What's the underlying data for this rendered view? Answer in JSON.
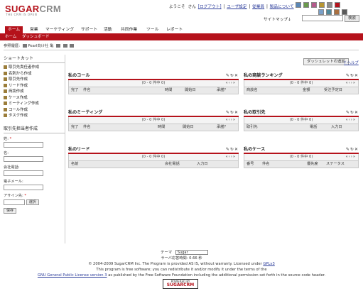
{
  "brand": {
    "logo_main": "SUGARCRM",
    "logo_sub": "THE CRM IS OPEN"
  },
  "header": {
    "greeting": "ようこそ",
    "user": "",
    "san": "さん",
    "logout": "[ログアウト]",
    "user_settings": "ユーザ設定",
    "employees": "従業員",
    "about": "製品について",
    "sitemap": "サイトマップ↓",
    "search_button": "検索",
    "search_value": ""
  },
  "colors": {
    "accent": "#b5121b",
    "swatches": [
      "#5a86b5",
      "#6a9a4c",
      "#b55a8c",
      "#b89532",
      "#8c8c8c",
      "#b5121b"
    ],
    "swatches2": [
      "#7aa0c8",
      "#4f8a9c",
      "#aa7040",
      "#5a5a5a"
    ]
  },
  "nav": {
    "tabs": [
      {
        "label": "ホーム",
        "active": true
      },
      {
        "label": "営業"
      },
      {
        "label": "マーケティング"
      },
      {
        "label": "サポート"
      },
      {
        "label": "活動"
      },
      {
        "label": "共同作業"
      },
      {
        "label": "ツール"
      },
      {
        "label": "レポート"
      }
    ]
  },
  "subnav": {
    "items": [
      "ホーム",
      "ダッシュボード"
    ]
  },
  "recent": {
    "label": "参照履歴:",
    "item": "Pearl向け社 亀"
  },
  "sidebar": {
    "shortcuts_title": "ショートカット",
    "shortcuts": [
      "取引先責任者作成",
      "名刺から作成",
      "取引先作成",
      "リード作成",
      "商談作成",
      "ケース作成",
      "ミーティング作成",
      "コール作成",
      "タスク作成"
    ],
    "quick_create_title": "取引先担当者作成",
    "fields": [
      {
        "label": "姓:",
        "required": true
      },
      {
        "label": "名:"
      },
      {
        "label": "会社電話:"
      },
      {
        "label": "電子メール:"
      }
    ],
    "assigned_label": "アサイン先:",
    "required_mark": "*",
    "assigned_value": "",
    "select_button": "選択",
    "save_button": "保存"
  },
  "main": {
    "add_dashlet": "ダッシュレットの追加",
    "help": "? ヘルプ"
  },
  "dashlets": [
    {
      "title": "私のコール",
      "paging": "(0 - 0 件中 0)",
      "columns": [
        "完了",
        "件名",
        "時間",
        "開始日",
        "承諾？"
      ]
    },
    {
      "title": "私の商談ランキング",
      "paging": "(0 - 0 件中 0)",
      "columns": [
        "商談名",
        "金額",
        "受注予定日"
      ]
    },
    {
      "title": "私のミーティング",
      "paging": "(0 - 0 件中 0)",
      "columns": [
        "完了",
        "件名",
        "時間",
        "開始日",
        "承諾？"
      ]
    },
    {
      "title": "私の取引先",
      "paging": "(0 - 0 件中 0)",
      "columns": [
        "取引先",
        "電話",
        "入力日"
      ]
    },
    {
      "title": "私のリード",
      "paging": "(0 - 0 件中 0)",
      "columns": [
        "名前",
        "会社電話",
        "入力日"
      ]
    },
    {
      "title": "私のケース",
      "paging": "(0 - 0 件中 0)",
      "columns": [
        "番号",
        "件名",
        "優先度",
        "ステータス"
      ]
    }
  ],
  "footer": {
    "theme_label": "テーマ",
    "theme_value": "Sugar",
    "server_time": "サーバ応答時間: 0.66 秒",
    "copyright": "© 2004-2009 SugarCRM Inc. The Program is provided AS IS, without warranty. Licensed under",
    "gpl": "GPLv3",
    "line2": "This program is free software; you can redistribute it and/or modify it under the terms of the",
    "gnu": "GNU General Public License version 3",
    "line3": "as published by the Free Software Foundation including the additional permission set forth in the source code header.",
    "powered_by": "POWERED BY",
    "powered_brand": "SUGARCRM"
  }
}
